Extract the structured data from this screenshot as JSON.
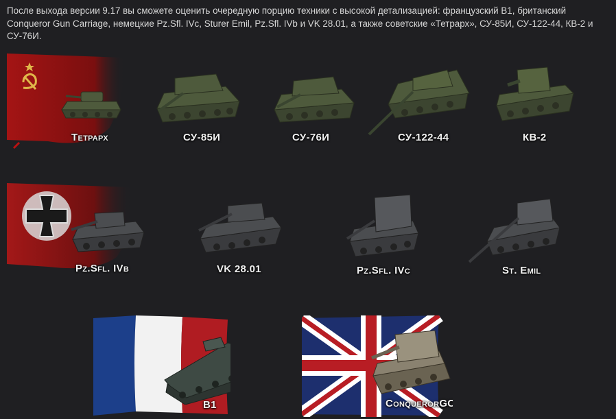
{
  "intro_text": "После выхода версии 9.17 вы сможете оценить очередную порцию техники с высокой детализацией: французский B1, британский Conqueror Gun Carriage, немецкие Pz.Sfl. IVc, Sturer Emil, Pz.Sfl. IVb и VK 28.01, а также советские «Тетрарх», СУ-85И, СУ-122-44, КВ-2 и СУ-76И.",
  "nations": {
    "ussr": {
      "flag_color": "#9b1414",
      "tanks": [
        {
          "name": "Тетрарх"
        },
        {
          "name": "СУ-85И"
        },
        {
          "name": "СУ-76И"
        },
        {
          "name": "СУ-122-44"
        },
        {
          "name": "КВ-2"
        }
      ]
    },
    "germany": {
      "flag_color": "#8e1818",
      "tanks": [
        {
          "name": "Pz.Sfl. IVb"
        },
        {
          "name": "VK 28.01"
        },
        {
          "name": "Pz.Sfl. IVc"
        },
        {
          "name": "St. Emil"
        }
      ]
    },
    "france": {
      "flag_colors": [
        "#1c3f8a",
        "#f2f2f2",
        "#b01c22"
      ],
      "tanks": [
        {
          "name": "B1"
        }
      ]
    },
    "uk": {
      "flag_colors": [
        "#1d2f6e",
        "#ffffff",
        "#b81d24"
      ],
      "tanks": [
        {
          "name": "ConquerorGC"
        }
      ]
    }
  },
  "colors": {
    "background": "#1f1f22",
    "soviet_tank": "#4e5a3c",
    "german_tank": "#4b4d50",
    "label": "#f0f0f0"
  },
  "icons": [
    "hammer-and-sickle-icon",
    "iron-cross-icon"
  ]
}
